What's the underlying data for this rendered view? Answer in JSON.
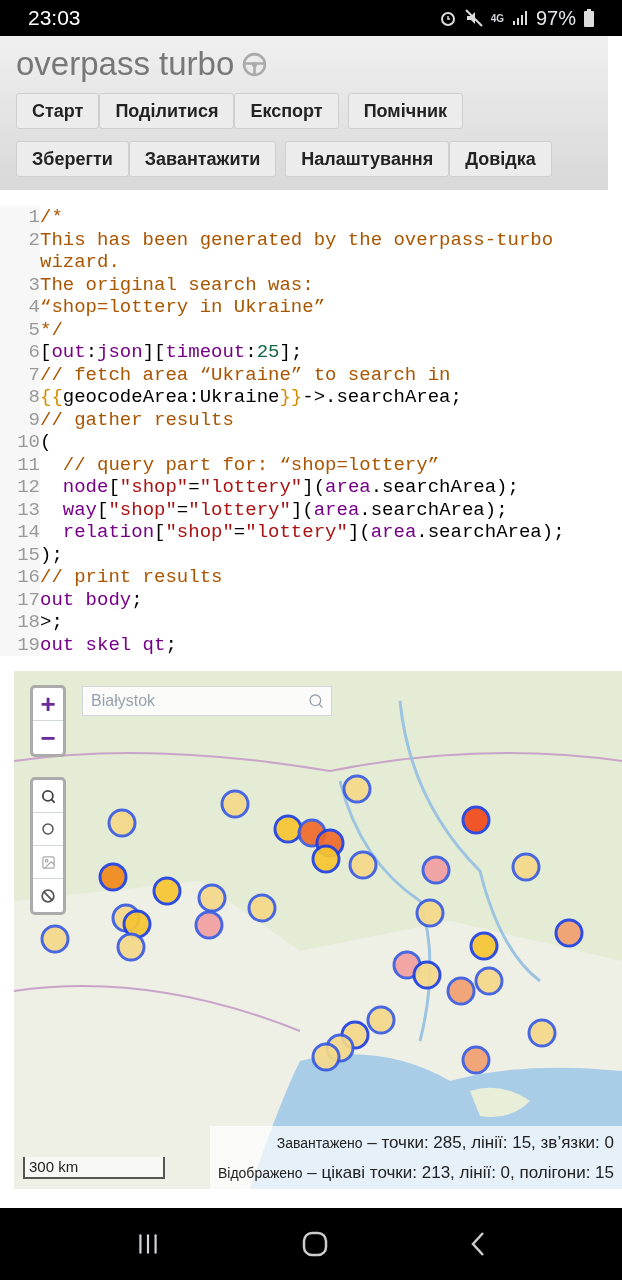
{
  "status_bar": {
    "time": "23:03",
    "network": "4G",
    "battery": "97%"
  },
  "header": {
    "title": "overpass turbo",
    "toolbar_rows": [
      {
        "groups": [
          [
            "Старт",
            "Поділитися",
            "Експорт"
          ],
          [
            "Помічник"
          ]
        ]
      },
      {
        "groups": [
          [
            "Зберегти",
            "Завантажити"
          ],
          [
            "Налаштування",
            "Довідка"
          ]
        ]
      }
    ]
  },
  "editor": {
    "lines": [
      {
        "number": "1",
        "tokens": [
          {
            "kind": "comment",
            "text": "/*"
          }
        ]
      },
      {
        "number": "2",
        "tokens": [
          {
            "kind": "comment",
            "text": "This has been generated by the overpass-turbo wizard."
          }
        ]
      },
      {
        "number": "3",
        "tokens": [
          {
            "kind": "comment",
            "text": "The original search was:"
          }
        ]
      },
      {
        "number": "4",
        "tokens": [
          {
            "kind": "comment",
            "text": "“shop=lottery in Ukraine”"
          }
        ]
      },
      {
        "number": "5",
        "tokens": [
          {
            "kind": "comment",
            "text": "*/"
          }
        ]
      },
      {
        "number": "6",
        "tokens": [
          {
            "kind": "plain",
            "text": "["
          },
          {
            "kind": "keyword",
            "text": "out"
          },
          {
            "kind": "plain",
            "text": ":"
          },
          {
            "kind": "keyword",
            "text": "json"
          },
          {
            "kind": "plain",
            "text": "]["
          },
          {
            "kind": "keyword",
            "text": "timeout"
          },
          {
            "kind": "plain",
            "text": ":"
          },
          {
            "kind": "number",
            "text": "25"
          },
          {
            "kind": "plain",
            "text": "];"
          }
        ]
      },
      {
        "number": "7",
        "tokens": [
          {
            "kind": "comment",
            "text": "// fetch area “Ukraine” to search in"
          }
        ]
      },
      {
        "number": "8",
        "tokens": [
          {
            "kind": "template",
            "text": "{{"
          },
          {
            "kind": "plain",
            "text": "geocodeArea:Ukraine"
          },
          {
            "kind": "template",
            "text": "}}"
          },
          {
            "kind": "plain",
            "text": "->.searchArea;"
          }
        ]
      },
      {
        "number": "9",
        "tokens": [
          {
            "kind": "comment",
            "text": "// gather results"
          }
        ]
      },
      {
        "number": "10",
        "tokens": [
          {
            "kind": "plain",
            "text": "("
          }
        ]
      },
      {
        "number": "11",
        "tokens": [
          {
            "kind": "comment",
            "text": "  // query part for: “shop=lottery”"
          }
        ]
      },
      {
        "number": "12",
        "tokens": [
          {
            "kind": "keyword",
            "text": "  node"
          },
          {
            "kind": "plain",
            "text": "["
          },
          {
            "kind": "string",
            "text": "\"shop\""
          },
          {
            "kind": "plain",
            "text": "="
          },
          {
            "kind": "string",
            "text": "\"lottery\""
          },
          {
            "kind": "plain",
            "text": "]("
          },
          {
            "kind": "keyword",
            "text": "area"
          },
          {
            "kind": "plain",
            "text": ".searchArea);"
          }
        ]
      },
      {
        "number": "13",
        "tokens": [
          {
            "kind": "keyword",
            "text": "  way"
          },
          {
            "kind": "plain",
            "text": "["
          },
          {
            "kind": "string",
            "text": "\"shop\""
          },
          {
            "kind": "plain",
            "text": "="
          },
          {
            "kind": "string",
            "text": "\"lottery\""
          },
          {
            "kind": "plain",
            "text": "]("
          },
          {
            "kind": "keyword",
            "text": "area"
          },
          {
            "kind": "plain",
            "text": ".searchArea);"
          }
        ]
      },
      {
        "number": "14",
        "tokens": [
          {
            "kind": "keyword",
            "text": "  relation"
          },
          {
            "kind": "plain",
            "text": "["
          },
          {
            "kind": "string",
            "text": "\"shop\""
          },
          {
            "kind": "plain",
            "text": "="
          },
          {
            "kind": "string",
            "text": "\"lottery\""
          },
          {
            "kind": "plain",
            "text": "]("
          },
          {
            "kind": "keyword",
            "text": "area"
          },
          {
            "kind": "plain",
            "text": ".searchArea);"
          }
        ]
      },
      {
        "number": "15",
        "tokens": [
          {
            "kind": "plain",
            "text": ");"
          }
        ]
      },
      {
        "number": "16",
        "tokens": [
          {
            "kind": "comment",
            "text": "// print results"
          }
        ]
      },
      {
        "number": "17",
        "tokens": [
          {
            "kind": "keyword",
            "text": "out body"
          },
          {
            "kind": "plain",
            "text": ";"
          }
        ]
      },
      {
        "number": "18",
        "tokens": [
          {
            "kind": "plain",
            "text": ">;"
          }
        ]
      },
      {
        "number": "19",
        "tokens": [
          {
            "kind": "keyword",
            "text": "out skel qt"
          },
          {
            "kind": "plain",
            "text": ";"
          }
        ]
      }
    ]
  },
  "map": {
    "search": {
      "placeholder": "Białystok"
    },
    "zoom_in": "+",
    "zoom_out": "−",
    "scale": "300 km",
    "stats": [
      {
        "label": "Завантажено",
        "value": " – точки: 285, лінії: 15, зв’язки: 0"
      },
      {
        "label": "Відображено",
        "value": " – цікаві точки: 213, лінії: 0, полігони: 15"
      }
    ]
  }
}
